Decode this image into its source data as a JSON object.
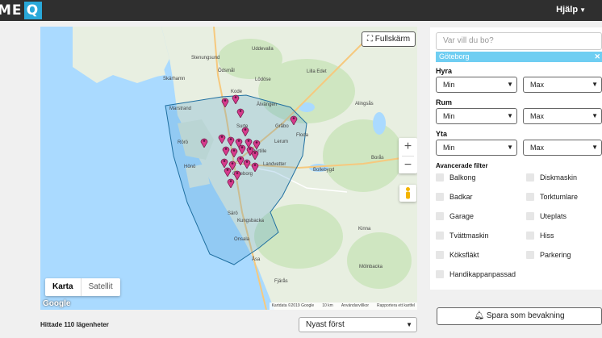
{
  "header": {
    "logo_text": "ME",
    "logo_box": "Q",
    "help_label": "Hjälp"
  },
  "map": {
    "fullscreen_label": "Fullskärm",
    "zoom_in": "+",
    "zoom_out": "−",
    "map_type_map": "Karta",
    "map_type_satellite": "Satellit",
    "google_label": "Google",
    "attribution": "Kartdata ©2019 Google",
    "scale": "10 km",
    "terms": "Användarvillkor",
    "report": "Rapportera ett kartfel",
    "place_labels": [
      "Stenungsund",
      "Uddevalla",
      "Lödöse",
      "Lilla Edet",
      "Skärhamn",
      "Ödsmål",
      "Kode",
      "Älvängen",
      "Marstrand",
      "Surte",
      "Gråbo",
      "Floda",
      "Rörö",
      "Hönö",
      "Partille",
      "Lerum",
      "Alingsås",
      "Göteborg",
      "Landvetter",
      "Bollebygd",
      "Borås",
      "Särö",
      "Kungsbacka",
      "Onsala",
      "Åsa",
      "Kinna",
      "Mölnbacka",
      "Fjärås"
    ],
    "pin_count": 110
  },
  "results": {
    "found_text": "Hittade 110 lägenheter",
    "sort_value": "Nyast först"
  },
  "filters": {
    "search_placeholder": "Var vill du bo?",
    "selected_location": "Göteborg",
    "hyra_label": "Hyra",
    "rum_label": "Rum",
    "yta_label": "Yta",
    "min": "Min",
    "max": "Max",
    "advanced_label": "Avancerade filter",
    "checkboxes": [
      "Balkong",
      "Diskmaskin",
      "Badkar",
      "Torktumlare",
      "Garage",
      "Uteplats",
      "Tvättmaskin",
      "Hiss",
      "Köksfläkt",
      "Parkering",
      "Handikappanpassad"
    ]
  },
  "save_label": "Spara som bevakning",
  "colors": {
    "accent": "#29a8d9",
    "tag": "#6fcef2",
    "pin": "#d63a8c",
    "water": "#aadaff",
    "land": "#e8efe1",
    "polygon": "#4a9bd1"
  }
}
